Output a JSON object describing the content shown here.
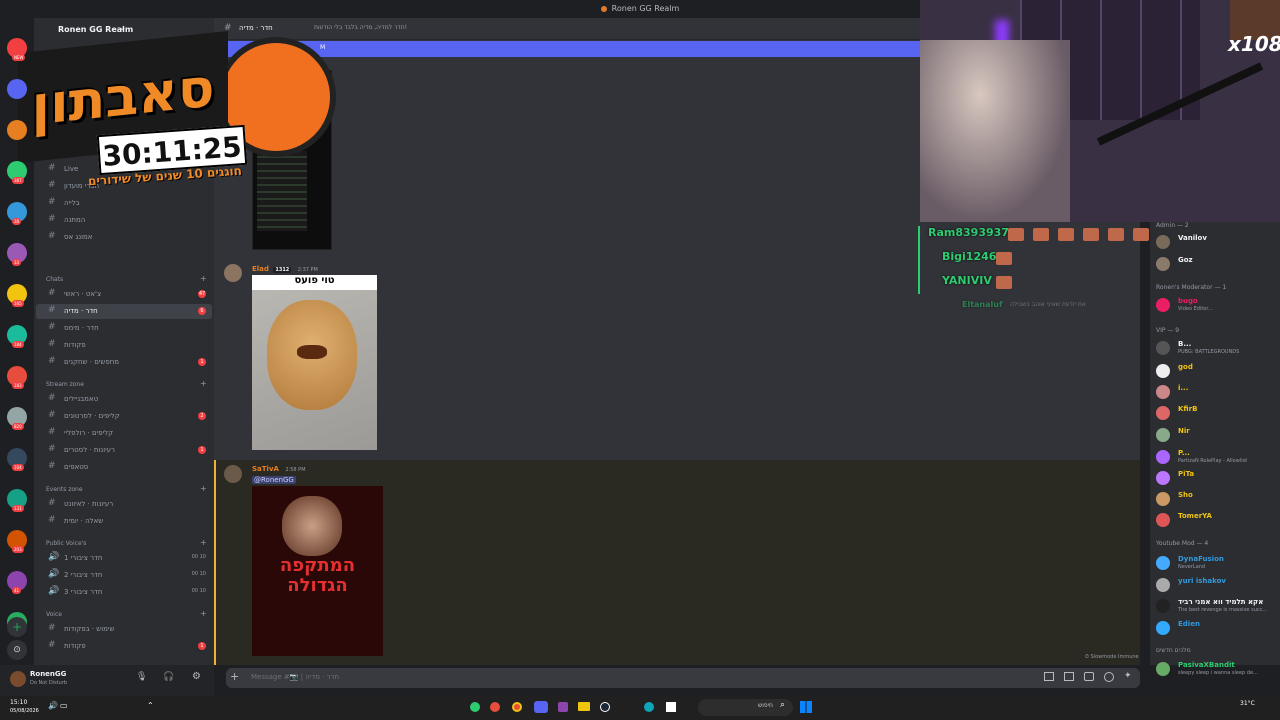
{
  "window": {
    "title": "Ronen GG Realm"
  },
  "server": {
    "name": "Ronen GG Realm"
  },
  "servers": [
    {
      "badge": "NEW"
    },
    {
      "badge": ""
    },
    {
      "badge": ""
    },
    {
      "badge": "387"
    },
    {
      "badge": "38"
    },
    {
      "badge": "33"
    },
    {
      "badge": "165"
    },
    {
      "badge": "184"
    },
    {
      "badge": "183"
    },
    {
      "badge": "820"
    },
    {
      "badge": "104"
    },
    {
      "badge": "131"
    },
    {
      "badge": "203"
    },
    {
      "badge": "41"
    },
    {
      "badge": "278"
    }
  ],
  "overlay": {
    "title": "סאבתון",
    "timer": "30:11:25",
    "subtitle": "חוגגים 10 שנים של שידורים"
  },
  "channels_top": [
    {
      "name": "ticke",
      "badge": ""
    },
    {
      "name": "Live",
      "badge": ""
    },
    {
      "name": "חברי מועדון",
      "badge": ""
    },
    {
      "name": "בלייה",
      "badge": ""
    },
    {
      "name": "המתנה",
      "badge": ""
    },
    {
      "name": "אמונג אס",
      "badge": ""
    }
  ],
  "categories": {
    "chats": "Chats",
    "stream_zone": "Stream zone",
    "events_zone": "Events zone",
    "public_voice": "Public Voice's",
    "voice": "Voice"
  },
  "chats": [
    {
      "name": "צ'אט · ראשי",
      "badge": "47"
    },
    {
      "name": "חדר · מדיה",
      "badge": "6"
    },
    {
      "name": "חדר · מימס",
      "badge": ""
    },
    {
      "name": "פקודות",
      "badge": ""
    },
    {
      "name": "מחפשים · שחקנים",
      "badge": "1"
    }
  ],
  "stream_zone": [
    {
      "name": "טאמבניילים",
      "badge": ""
    },
    {
      "name": "קליפים · לסרטונים",
      "badge": "2"
    },
    {
      "name": "קליפים · רולפליי",
      "badge": ""
    },
    {
      "name": "רעיונות · לסטרים",
      "badge": "1"
    },
    {
      "name": "סטאפים",
      "badge": ""
    }
  ],
  "events_zone": [
    {
      "name": "רעיונות · לאיוונט",
      "badge": ""
    },
    {
      "name": "שאלה · יומית",
      "badge": ""
    }
  ],
  "public_voice": [
    {
      "name": "חדר ציבורי 1",
      "count": "00",
      "limit": "10"
    },
    {
      "name": "חדר ציבורי 2",
      "count": "00",
      "limit": "10"
    },
    {
      "name": "חדר ציבורי 3",
      "count": "00",
      "limit": "10"
    }
  ],
  "voice": [
    {
      "name": "שימוש · בפקודות",
      "badge": ""
    },
    {
      "name": "פקודות",
      "badge": "1"
    }
  ],
  "user": {
    "name": "RonenGG",
    "status": "Do Not Disturb"
  },
  "chat_header": {
    "channel": "חדר · מדיה",
    "topic": "חדר למדיה, מדיה בלבד בלי הודעות!"
  },
  "new_messages": "M",
  "messages": [
    {
      "author": "Elad",
      "tag": "1312",
      "time": "2:37 PM",
      "caption": "טוי פועס"
    },
    {
      "author": "SaTivA",
      "time": "2:58 PM",
      "mention": "@RonenGG",
      "poster_title": "המתקפה הגדולה"
    }
  ],
  "stream_chat": [
    {
      "name": "Ram8393937",
      "color": "#2ecc71"
    },
    {
      "name": "Bigi1246",
      "color": "#2ecc71"
    },
    {
      "name": "YANIVIV",
      "color": "#2ecc71"
    },
    {
      "name": "Eltanaluf",
      "text": "את יודעת שאיני אוהב בשבילה",
      "color": "#2ecc71"
    }
  ],
  "stream_badge": "x108",
  "member_groups": {
    "admin": "Admin — 2",
    "moderator": "Ronen's Moderator — 1",
    "vip": "VIP — 9",
    "youtube": "Youtube Mod — 4",
    "other": "מלכים חדשים"
  },
  "members": [
    {
      "name": "Vanilov",
      "sub": "",
      "color": "#f2f3f5"
    },
    {
      "name": "Goz",
      "sub": "",
      "color": "#f2f3f5"
    },
    {
      "name": "bugo",
      "sub": "Video Editor...",
      "color": "#e91e63"
    },
    {
      "name": "B...",
      "sub": "PUBG: BATTLEGROUNDS",
      "color": "#f2f3f5"
    },
    {
      "name": "god",
      "sub": "",
      "color": "#f1c40f"
    },
    {
      "name": "i...",
      "sub": "",
      "color": "#f1c40f"
    },
    {
      "name": "KfirB",
      "sub": "",
      "color": "#f1c40f"
    },
    {
      "name": "Nir",
      "sub": "",
      "color": "#f1c40f"
    },
    {
      "name": "P...",
      "sub": "PartizaN RolePlay - Allowlist",
      "color": "#f1c40f"
    },
    {
      "name": "PiTa",
      "sub": "",
      "color": "#f1c40f"
    },
    {
      "name": "Sho",
      "sub": "",
      "color": "#f1c40f"
    },
    {
      "name": "TomerYA",
      "sub": "",
      "color": "#f1c40f"
    },
    {
      "name": "DynaFusion",
      "sub": "NeverLand",
      "color": "#3498db"
    },
    {
      "name": "yuri ishakov",
      "sub": "",
      "color": "#3498db"
    },
    {
      "name": "אקא תלמיד ווא אמני רביד",
      "sub": "The best revenge is massive succ...",
      "color": "#f2f3f5"
    },
    {
      "name": "Edien",
      "sub": "",
      "color": "#3498db"
    },
    {
      "name": "PasivaXBandit",
      "sub": "sleepy sleep i wanna sleep de...",
      "color": "#2ecc71"
    }
  ],
  "slowmode": "Slowmode Immune",
  "message_placeholder": "Message #📷 | חדר · מדיה",
  "taskbar": {
    "time": "15:10",
    "date": "05/08/2026",
    "weather": "31°C",
    "search": "חיפוש"
  },
  "colors": {
    "accent": "#5865f2",
    "overlay_orange": "#e8771e",
    "stream_bg": "#3a3044"
  }
}
